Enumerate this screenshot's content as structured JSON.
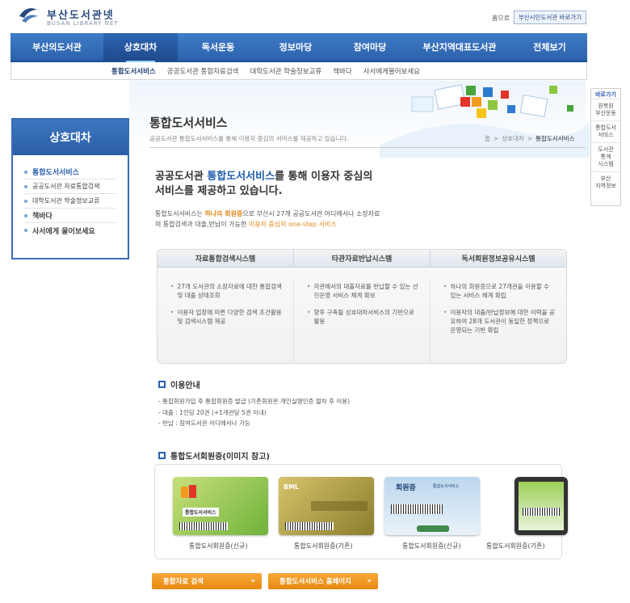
{
  "header": {
    "logo_ko": "부산도서관넷",
    "logo_en": "BUSAN LIBRARY NET",
    "home_link": "홈으로",
    "citizen_link": "부산시민도서관 바로가기"
  },
  "gnb": [
    "부산의도서관",
    "상호대차",
    "독서운동",
    "정보마당",
    "참여마당",
    "부산지역대표도서관",
    "전체보기"
  ],
  "sub_nav": [
    "통합도서서비스",
    "공공도서관 통합자료검색",
    "대학도서관 학술정보교류",
    "책바다",
    "사서에게물어보세요"
  ],
  "lnb": {
    "title": "상호대차",
    "items": [
      "통합도서서비스",
      "공공도서관 자료통합검색",
      "대학도서관 학술정보교류",
      "책바다",
      "사서에게 물어보세요"
    ]
  },
  "quick": {
    "title": "바로가기",
    "items": [
      "원북원\n부산운동",
      "통합도서\n서비스",
      "도서관\n통계\n시스템",
      "부산\n지역정보"
    ]
  },
  "page": {
    "title": "통합도서서비스",
    "desc": "공공도서관 통합도서서비스를 통해 이용자 중심의 서비스를 제공하고 있습니다.",
    "crumb": [
      "홈",
      ">",
      "상호대차",
      ">",
      "통합도서서비스"
    ]
  },
  "headline": {
    "pre": "공공도서관 ",
    "strong": "통합도서서비스",
    "post": "를 통해 이용자 중심의",
    "line2": "서비스를 제공하고 있습니다."
  },
  "intro": {
    "a": "통합도서서비스는 ",
    "b": "하나의 회원증",
    "c": "으로 부산시 27개 공공도서관 어디에서나 소장자료의 통합검색과 대출,반납이 가능한 ",
    "d": "이용자 중심의 one-step 서비스"
  },
  "systems": {
    "tabs": [
      "자료통합검색시스템",
      "타관자료반납시스템",
      "독서회원정보공유시스템"
    ],
    "cols": [
      [
        "27개 도서관의 소장자료에 대한 통합검색 및 대출 상태조회",
        "이용자 입장에 따른 다양한 검색 조건활용 및 검색시스템 제공"
      ],
      [
        "자관에서의 대출자료를 반납할 수 있는 선진운영 서비스 체계 확보",
        "향후 구축될 상호대차서비스의 기반으로 활용"
      ],
      [
        "하나의 회원증으로 27개관을 이용할 수 있는 서비스 체계 확립",
        "이용자의 대출/반납정보에 대한 이력을 공유하여 28개 도서관이 동일한 정책으로 운영되는 기반 확립"
      ]
    ]
  },
  "usage": {
    "title": "이용안내",
    "lines": [
      "- 통합회원가입 후 통합회원증 발급 (기존회원은 개인실명인증 절차 후 이용)",
      "- 대출 : 1인당 20권 (+1개관당 5권 이내)",
      "- 반납 : 참여도서관 어디에서나 가능"
    ]
  },
  "cards": {
    "title": "통합도서회원증(이미지 참고)",
    "labels": [
      "통합도서회원증(신규)",
      "통합도서회원증(기존)",
      "통합도서회원증(신규)",
      "통합도서회원증(기존)"
    ],
    "card1_text": "통합도서서비스",
    "card2_text": "BML",
    "card3_text": "회원증",
    "card3_sub": "통합도서서비스"
  },
  "buttons": [
    "통합자료 검색",
    "통합도서서비스 홈페이지"
  ],
  "colors": {
    "brand": "#2c62ab",
    "accent": "#e8880f"
  }
}
